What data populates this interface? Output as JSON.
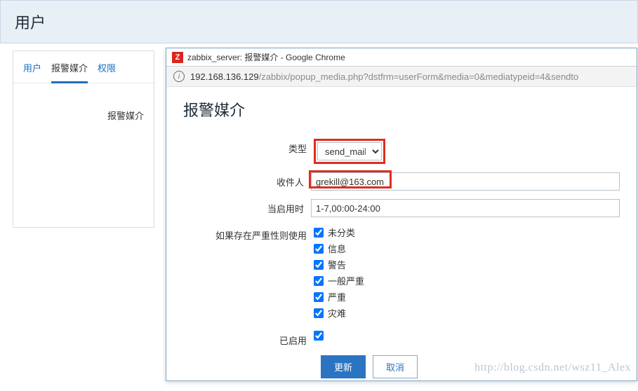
{
  "header": {
    "title": "用户"
  },
  "tabs": {
    "user": "用户",
    "media": "报警媒介",
    "perm": "权限",
    "sublabel": "报警媒介"
  },
  "popup": {
    "title": "zabbix_server: 报警媒介 - Google Chrome",
    "url_host": "192.168.136.129",
    "url_path": "/zabbix/popup_media.php?dstfrm=userForm&media=0&mediatypeid=4&sendto",
    "heading": "报警媒介",
    "form": {
      "type_label": "类型",
      "type_value": "send_mail",
      "recipient_label": "收件人",
      "recipient_value": "grekill@163.com",
      "when_label": "当启用时",
      "when_value": "1-7,00:00-24:00",
      "severity_label": "如果存在严重性则使用",
      "severities": [
        "未分类",
        "信息",
        "警告",
        "一般严重",
        "严重",
        "灾难"
      ],
      "enabled_label": "已启用"
    },
    "buttons": {
      "update": "更新",
      "cancel": "取消"
    }
  },
  "watermark": "http://blog.csdn.net/wsz11_Alex"
}
